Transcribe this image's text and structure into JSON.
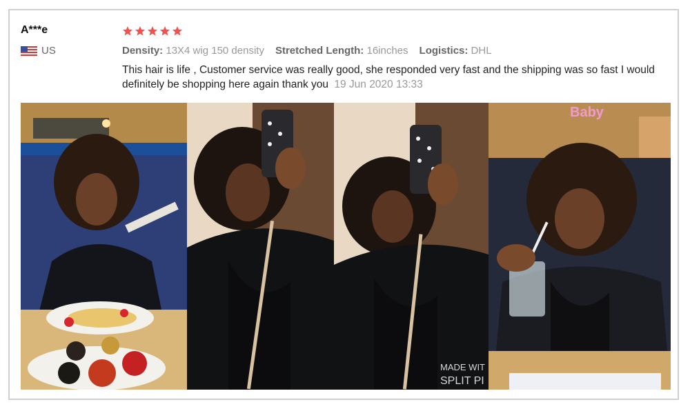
{
  "reviewer": {
    "name": "A***e",
    "country": "US",
    "flag_icon": "us-flag-icon"
  },
  "review": {
    "rating": 5,
    "star_color": "#f0524d",
    "attributes": [
      {
        "key": "Density:",
        "value": "13X4 wig 150 density"
      },
      {
        "key": "Stretched Length:",
        "value": "16inches"
      },
      {
        "key": "Logistics:",
        "value": "DHL"
      }
    ],
    "text": "This hair is life , Customer service was really good, she responded very fast and the shipping was so fast I would definitely be shopping here again thank you",
    "date": "19 Jun 2020 13:33"
  },
  "photos": {
    "watermark_line1": "MADE WIT",
    "watermark_line2": "SPLIT PI",
    "sign_text": "Baby"
  }
}
